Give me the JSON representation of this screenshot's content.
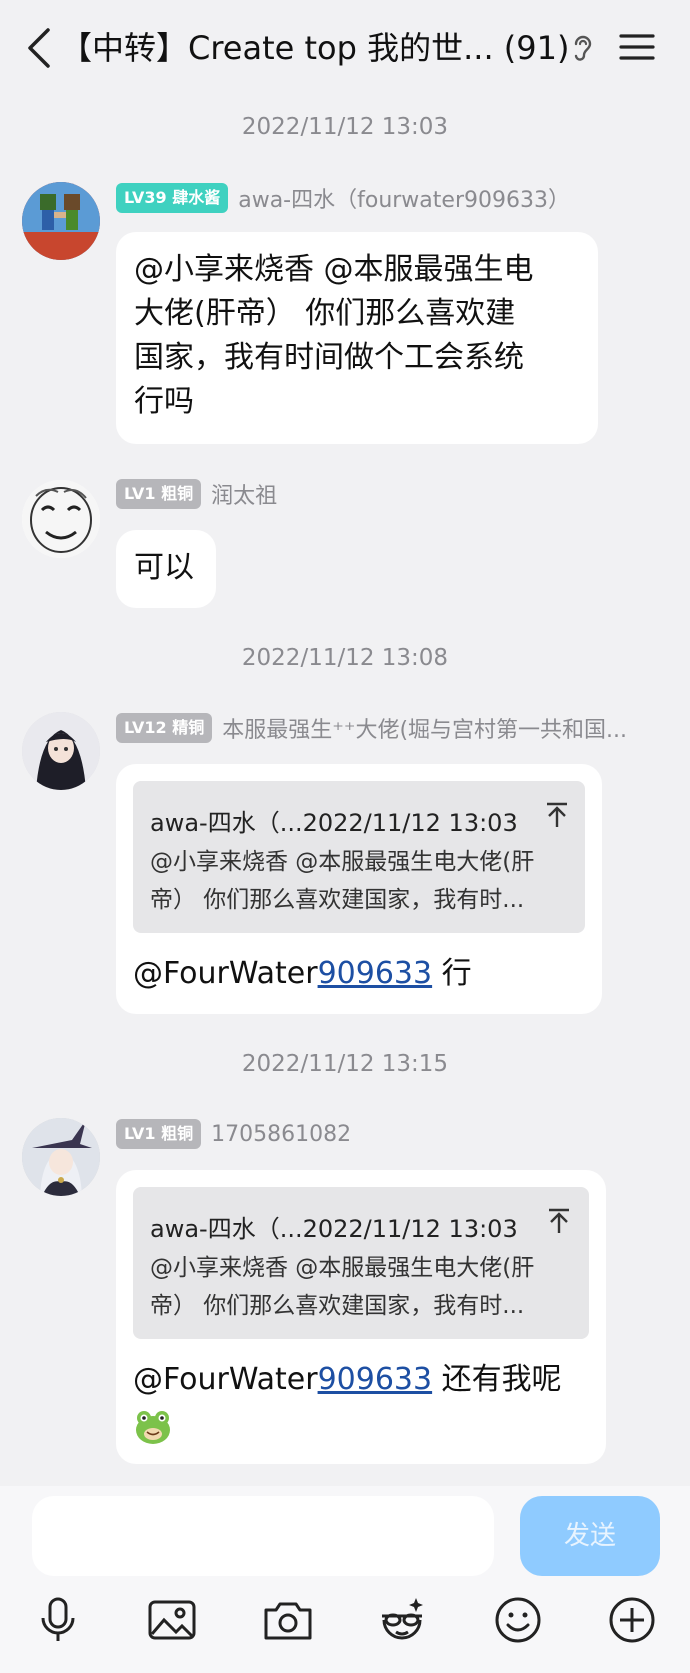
{
  "header": {
    "title": "【中转】Create top 我的世... (91)"
  },
  "messages": [
    {
      "time": "2022/11/12 13:03",
      "badge": "LV39 肆水酱",
      "badge_color": "#3fd1c0",
      "nick": "awa-四水（fourwater909633）",
      "lines": [
        "@小享来烧香 @本服最强生电",
        "大佬(肝帝） 你们那么喜欢建",
        "国家，我有时间做个工会系统",
        "行吗"
      ]
    },
    {
      "badge": "LV1 粗铜",
      "badge_color": "#b6b6ba",
      "nick": "润太祖",
      "text": "可以"
    },
    {
      "time": "2022/11/12 13:08",
      "badge": "LV12 精铜",
      "badge_color": "#b6b6ba",
      "nick": "本服最强生⁺⁺大佬(堀与宫村第一共和国...",
      "quote": {
        "head": "awa-四水（...2022/11/12 13:03",
        "body": "@小享来烧香 @本服最强生电大佬(肝帝） 你们那么喜欢建国家，我有时..."
      },
      "reply_prefix": "@FourWater",
      "reply_link": "909633",
      "reply_suffix": " 行"
    },
    {
      "time": "2022/11/12 13:15",
      "badge": "LV1 粗铜",
      "badge_color": "#b6b6ba",
      "nick": "1705861082",
      "quote": {
        "head": "awa-四水（...2022/11/12 13:03",
        "body": "@小享来烧香 @本服最强生电大佬(肝帝） 你们那么喜欢建国家，我有时..."
      },
      "reply_prefix": "@FourWater",
      "reply_link": "909633",
      "reply_suffix": " 还有我呢"
    }
  ],
  "composer": {
    "send_label": "发送",
    "accent": "#8fcbff"
  },
  "toolbar": [
    "microphone-icon",
    "image-icon",
    "camera-icon",
    "fun-face-icon",
    "emoji-icon",
    "plus-icon"
  ]
}
